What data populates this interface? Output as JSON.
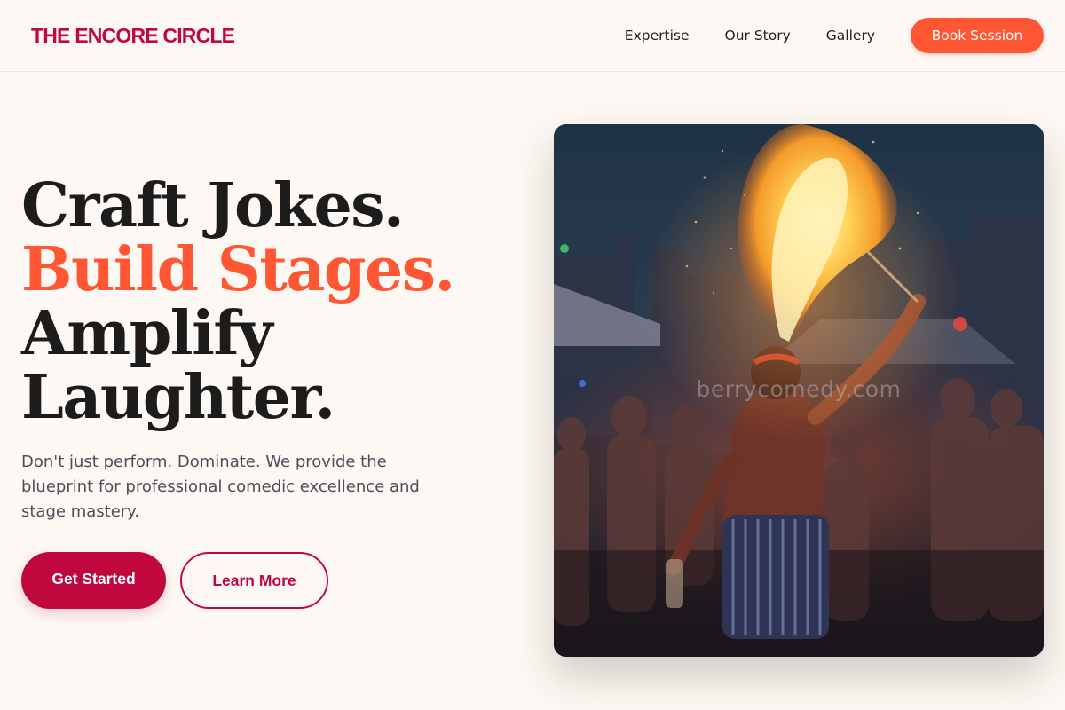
{
  "brand": {
    "name": "THE ENCORE CIRCLE",
    "color": "#c0083f"
  },
  "nav": {
    "links": [
      "Expertise",
      "Our Story",
      "Gallery"
    ],
    "cta_label": "Book Session",
    "cta_color": "#ff5733"
  },
  "hero": {
    "title_lines": [
      "Craft Jokes.",
      "Build Stages.",
      "Amplify",
      "Laughter."
    ],
    "accent_color": "#ff5733",
    "description": "Don't just perform. Dominate. We provide the blueprint for professional comedic excellence and stage mastery.",
    "primary_button": "Get Started",
    "secondary_button": "Learn More"
  },
  "image": {
    "subject": "fire breather performing at night in front of a crowd",
    "watermark": "berrycomedy.com"
  }
}
